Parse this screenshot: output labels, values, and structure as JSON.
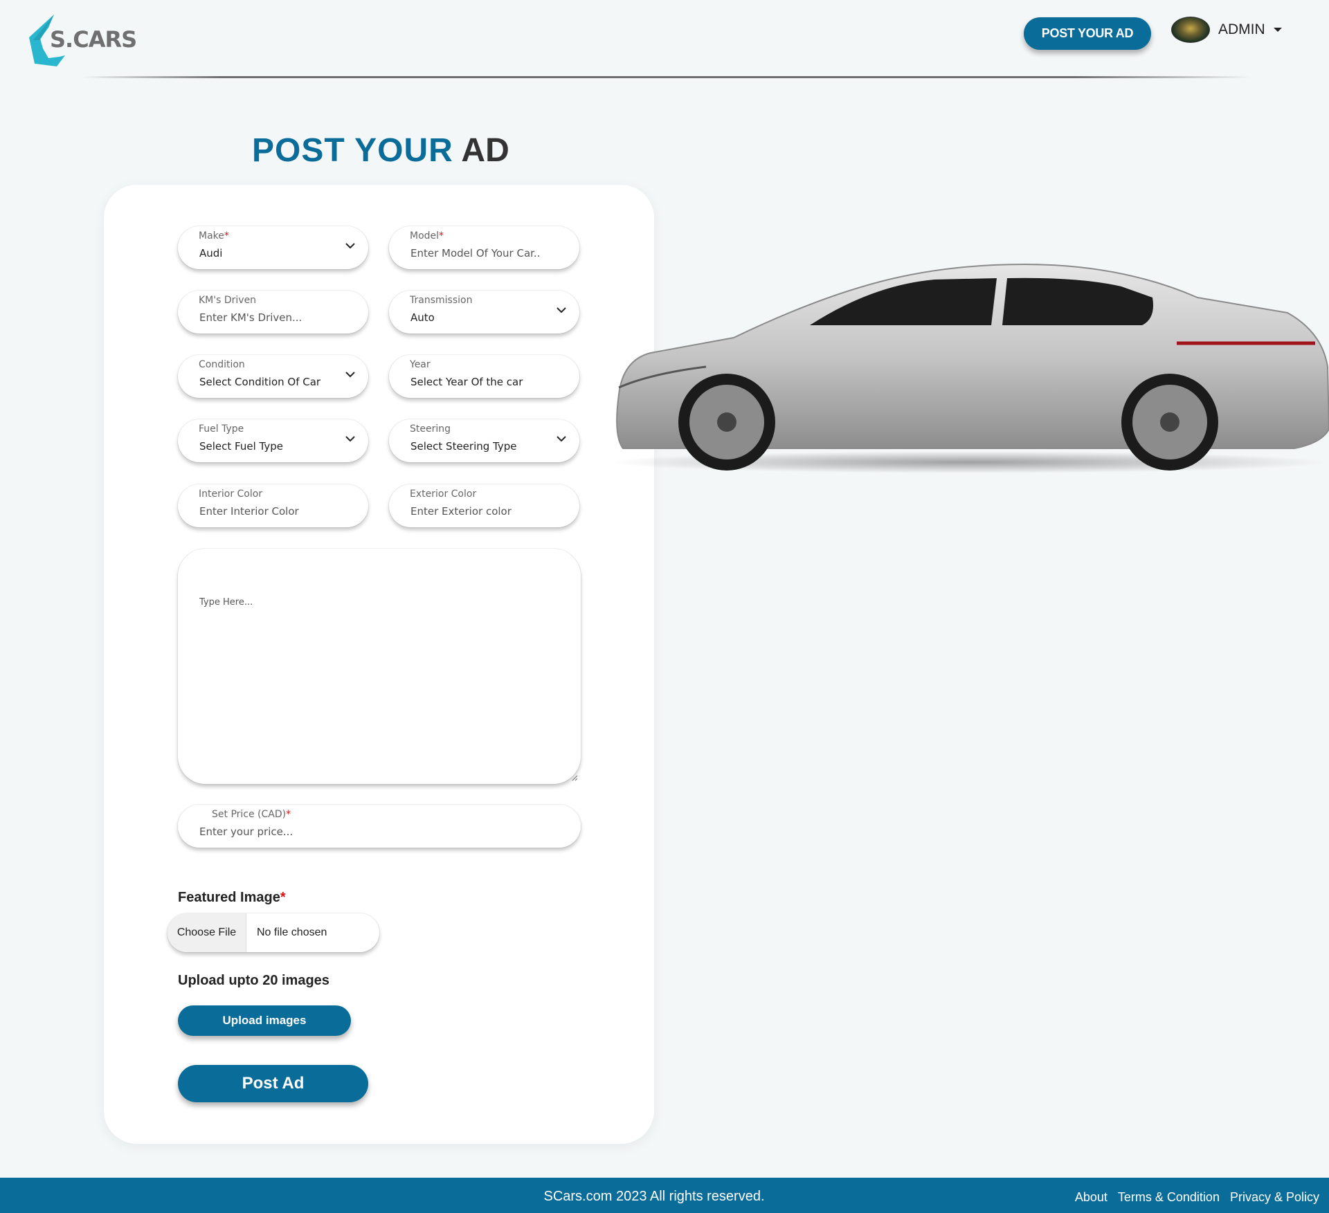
{
  "header": {
    "logo_text": "S.CARS",
    "post_button": "POST YOUR AD",
    "user_label": "ADMIN"
  },
  "title": {
    "part_a": "POST YOUR",
    "part_b": "AD"
  },
  "form": {
    "make": {
      "label": "Make",
      "value": "Audi"
    },
    "model": {
      "label": "Model",
      "placeholder": "Enter Model Of Your Car.."
    },
    "kms": {
      "label": "KM's Driven",
      "placeholder": "Enter KM's Driven..."
    },
    "transmission": {
      "label": "Transmission",
      "value": "Auto"
    },
    "condition": {
      "label": "Condition",
      "value": "Select Condition Of Car"
    },
    "year": {
      "label": "Year",
      "value": "Select Year Of the car"
    },
    "fuel": {
      "label": "Fuel Type",
      "value": "Select Fuel Type"
    },
    "steering": {
      "label": "Steering",
      "value": "Select Steering Type"
    },
    "interior": {
      "label": "Interior Color",
      "placeholder": "Enter Interior Color"
    },
    "exterior": {
      "label": "Exterior Color",
      "placeholder": "Enter Exterior color"
    },
    "description": {
      "placeholder": "Type Here..."
    },
    "price": {
      "label": "Set Price (CAD)",
      "placeholder": "Enter your price..."
    },
    "required_mark": "*",
    "featured_label": "Featured Image",
    "file_button": "Choose File",
    "file_status": "No file chosen",
    "upload_label": "Upload upto 20 images",
    "upload_button": "Upload images",
    "submit_button": "Post Ad"
  },
  "footer": {
    "copyright": "SCars.com 2023 All rights reserved.",
    "links": [
      "About",
      "Terms & Condition",
      "Privacy & Policy"
    ]
  },
  "colors": {
    "brand": "#0a6c98",
    "accent_logo": "#2bb6cf",
    "required": "#dd1111"
  },
  "icons": {
    "dropdown": "chevron-down-icon",
    "user_menu": "caret-down-icon"
  }
}
